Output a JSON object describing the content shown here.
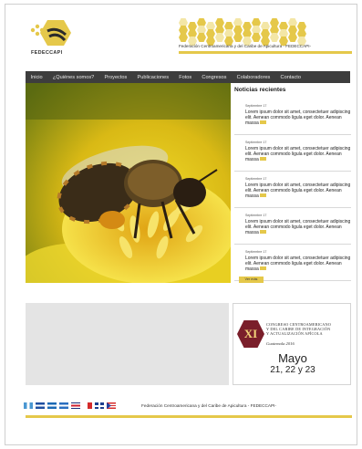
{
  "header": {
    "logo_text": "FEDECCAPI",
    "org_title": "Federación Centroamericana y del Caribe de Apicultura - FEDECCAPI-"
  },
  "nav": {
    "items": [
      {
        "label": "Inicio"
      },
      {
        "label": "¿Quiénes somos?"
      },
      {
        "label": "Proyectos"
      },
      {
        "label": "Publicaciones"
      },
      {
        "label": "Fotos"
      },
      {
        "label": "Congresos"
      },
      {
        "label": "Colaboradores"
      },
      {
        "label": "Contacto"
      }
    ]
  },
  "news": {
    "title": "Noticias recientes",
    "items": [
      {
        "date": "Septiembre 17",
        "body": "Lorem ipsum dolor sit amet, consectetuer adipiscing elit. Aenean commodo ligula eget dolor. Aenean massa"
      },
      {
        "date": "Septiembre 17",
        "body": "Lorem ipsum dolor sit amet, consectetuer adipiscing elit. Aenean commodo ligula eget dolor. Aenean massa"
      },
      {
        "date": "Septiembre 17",
        "body": "Lorem ipsum dolor sit amet, consectetuer adipiscing elit. Aenean commodo ligula eget dolor. Aenean massa"
      },
      {
        "date": "Septiembre 17",
        "body": "Lorem ipsum dolor sit amet, consectetuer adipiscing elit. Aenean commodo ligula eget dolor. Aenean massa"
      },
      {
        "date": "Septiembre 17",
        "body": "Lorem ipsum dolor sit amet, consectetuer adipiscing elit. Aenean commodo ligula eget dolor. Aenean massa"
      }
    ],
    "more_label": "Ver más"
  },
  "congress": {
    "number": "XI",
    "line1": "Congreso Centroamericano",
    "line2": "y del Caribe de Integración",
    "line3": "y actualización Apícola",
    "place": "Guatemala 2016",
    "month": "Mayo",
    "days": "21, 22 y 23"
  },
  "footer": {
    "text": "Federación Centroamericana y del Caribe de Apicultura - FEDECCAPI-"
  },
  "colors": {
    "accent": "#e5c84a",
    "nav_bg": "#3d3d3d",
    "congress_badge": "#7a1e2a"
  }
}
